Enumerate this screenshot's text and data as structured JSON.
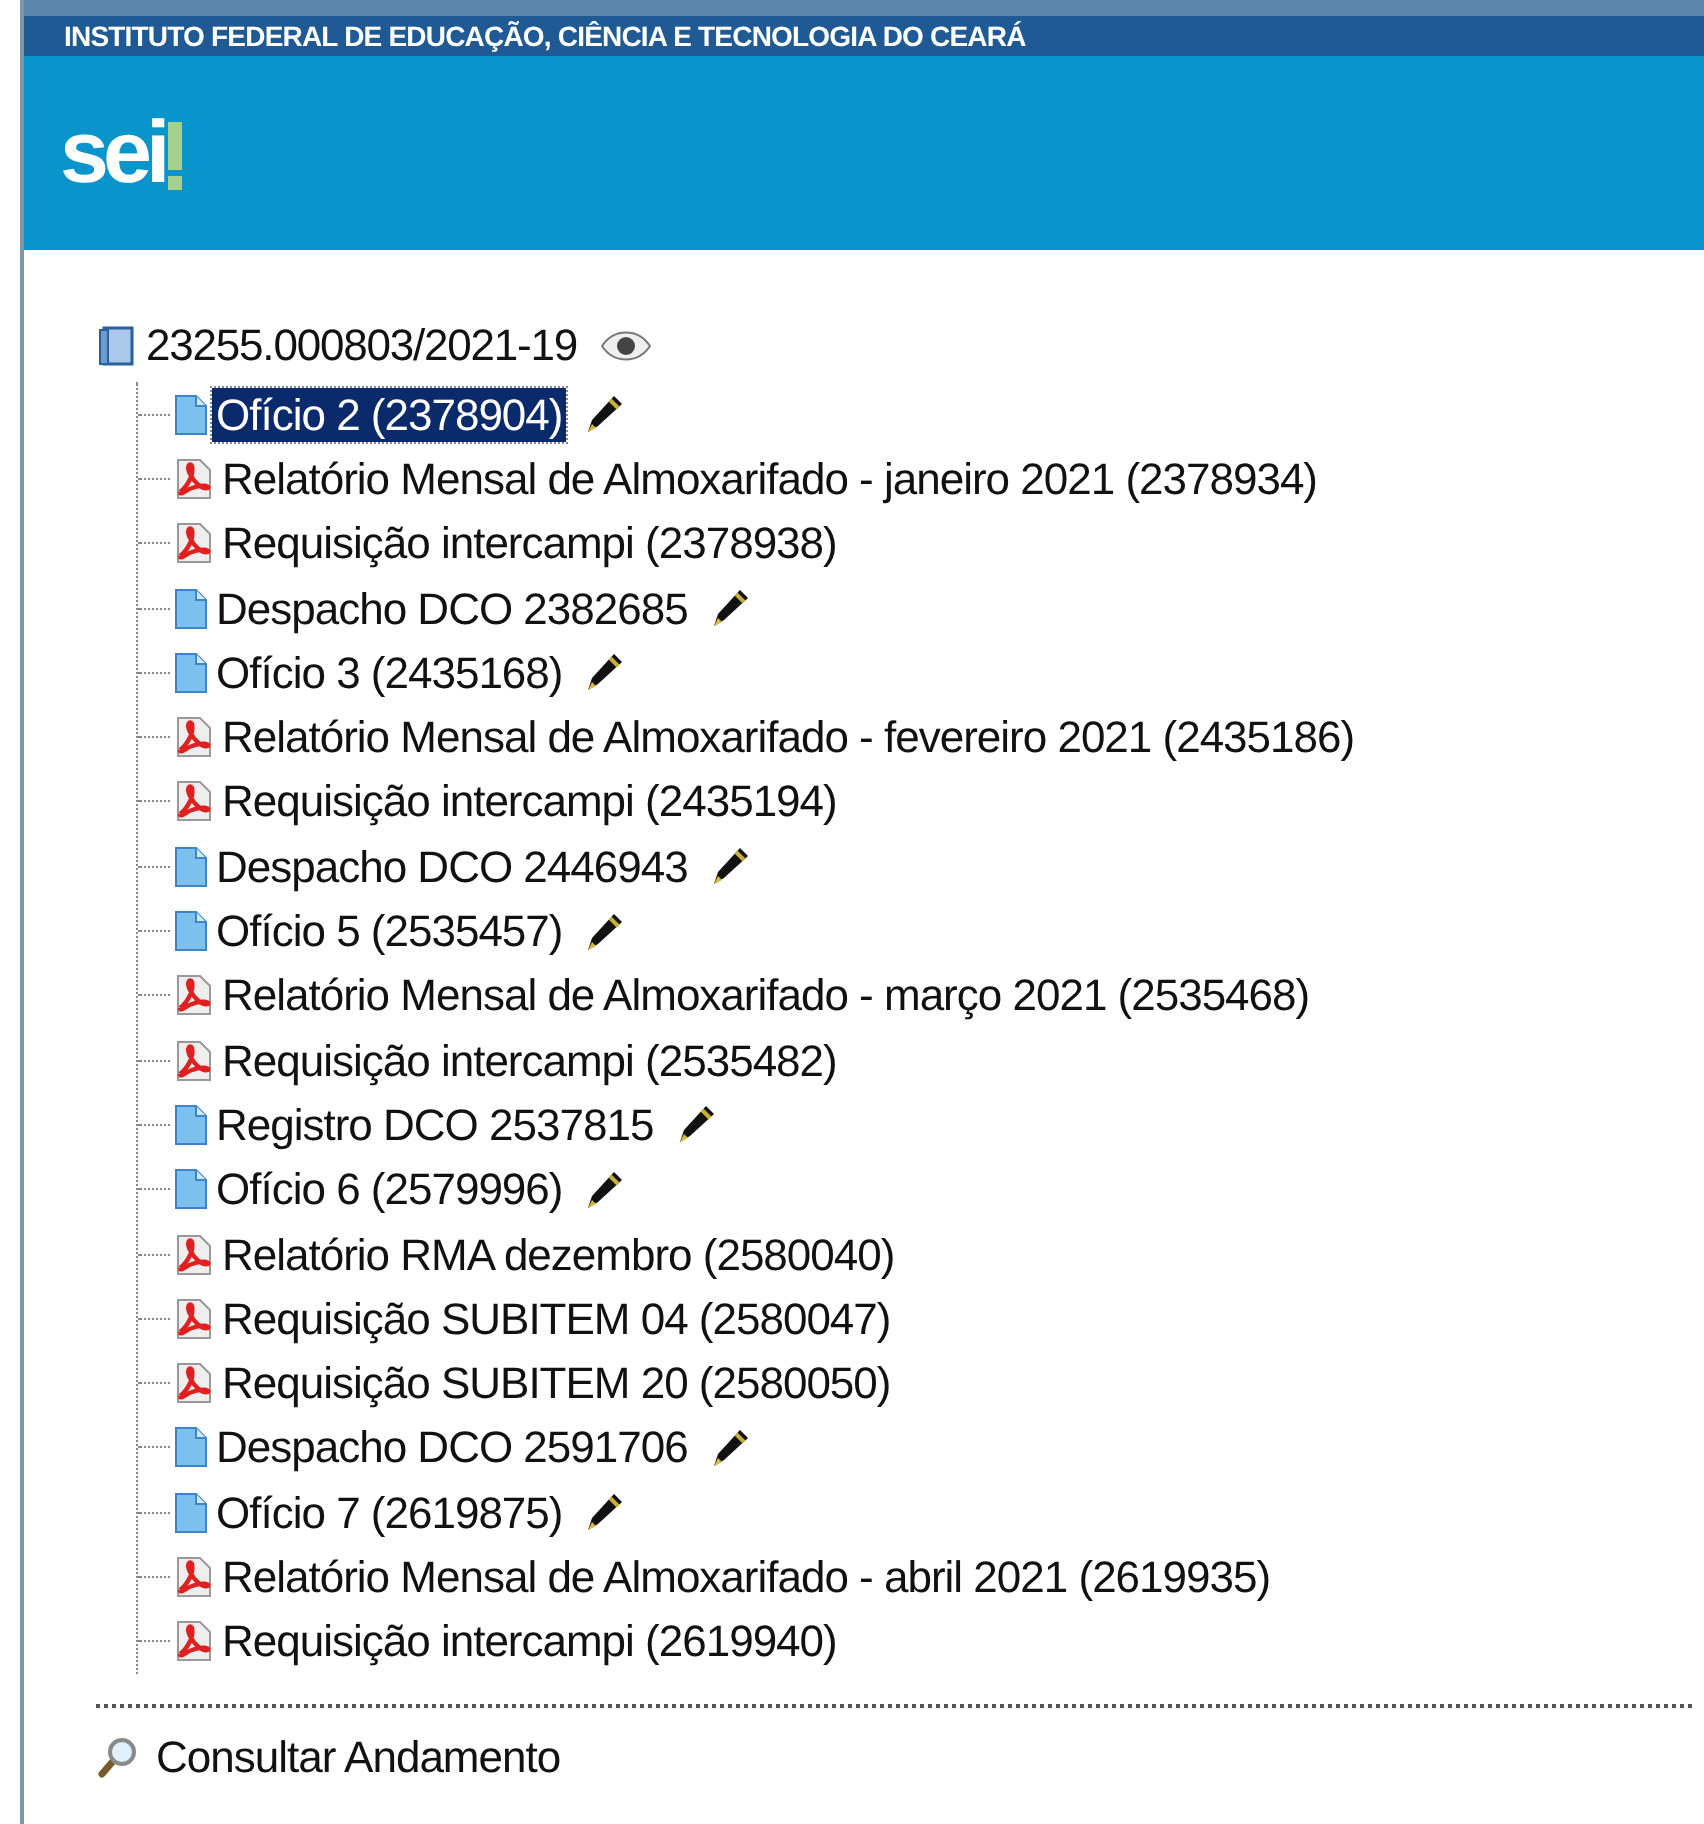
{
  "header": {
    "institution": "INSTITUTO FEDERAL DE EDUCAÇÃO, CIÊNCIA E TECNOLOGIA DO CEARÁ",
    "logo": "sei"
  },
  "tree": {
    "process": "23255.000803/2021-19",
    "items": [
      {
        "kind": "doc",
        "label": "Ofício 2 (2378904)",
        "signed": true,
        "selected": true
      },
      {
        "kind": "pdf",
        "label": "Relatório Mensal de Almoxarifado - janeiro 2021 (2378934)",
        "signed": false,
        "selected": false
      },
      {
        "kind": "pdf",
        "label": "Requisição intercampi (2378938)",
        "signed": false,
        "selected": false
      },
      {
        "kind": "doc",
        "label": "Despacho DCO 2382685",
        "signed": true,
        "selected": false
      },
      {
        "kind": "doc",
        "label": "Ofício 3 (2435168)",
        "signed": true,
        "selected": false
      },
      {
        "kind": "pdf",
        "label": "Relatório Mensal de Almoxarifado - fevereiro 2021 (2435186)",
        "signed": false,
        "selected": false
      },
      {
        "kind": "pdf",
        "label": "Requisição intercampi (2435194)",
        "signed": false,
        "selected": false
      },
      {
        "kind": "doc",
        "label": "Despacho DCO 2446943",
        "signed": true,
        "selected": false
      },
      {
        "kind": "doc",
        "label": "Ofício 5 (2535457)",
        "signed": true,
        "selected": false
      },
      {
        "kind": "pdf",
        "label": "Relatório Mensal de Almoxarifado - março 2021 (2535468)",
        "signed": false,
        "selected": false
      },
      {
        "kind": "pdf",
        "label": "Requisição intercampi (2535482)",
        "signed": false,
        "selected": false
      },
      {
        "kind": "doc",
        "label": "Registro DCO 2537815",
        "signed": true,
        "selected": false
      },
      {
        "kind": "doc",
        "label": "Ofício 6 (2579996)",
        "signed": true,
        "selected": false
      },
      {
        "kind": "pdf",
        "label": "Relatório RMA dezembro (2580040)",
        "signed": false,
        "selected": false
      },
      {
        "kind": "pdf",
        "label": "Requisição SUBITEM 04 (2580047)",
        "signed": false,
        "selected": false
      },
      {
        "kind": "pdf",
        "label": "Requisição SUBITEM 20 (2580050)",
        "signed": false,
        "selected": false
      },
      {
        "kind": "doc",
        "label": "Despacho DCO 2591706",
        "signed": true,
        "selected": false
      },
      {
        "kind": "doc",
        "label": "Ofício 7 (2619875)",
        "signed": true,
        "selected": false
      },
      {
        "kind": "pdf",
        "label": "Relatório Mensal de Almoxarifado - abril 2021 (2619935)",
        "signed": false,
        "selected": false
      },
      {
        "kind": "pdf",
        "label": "Requisição intercampi (2619940)",
        "signed": false,
        "selected": false
      }
    ]
  },
  "actions": [
    {
      "label": "Consultar Andamento"
    }
  ]
}
